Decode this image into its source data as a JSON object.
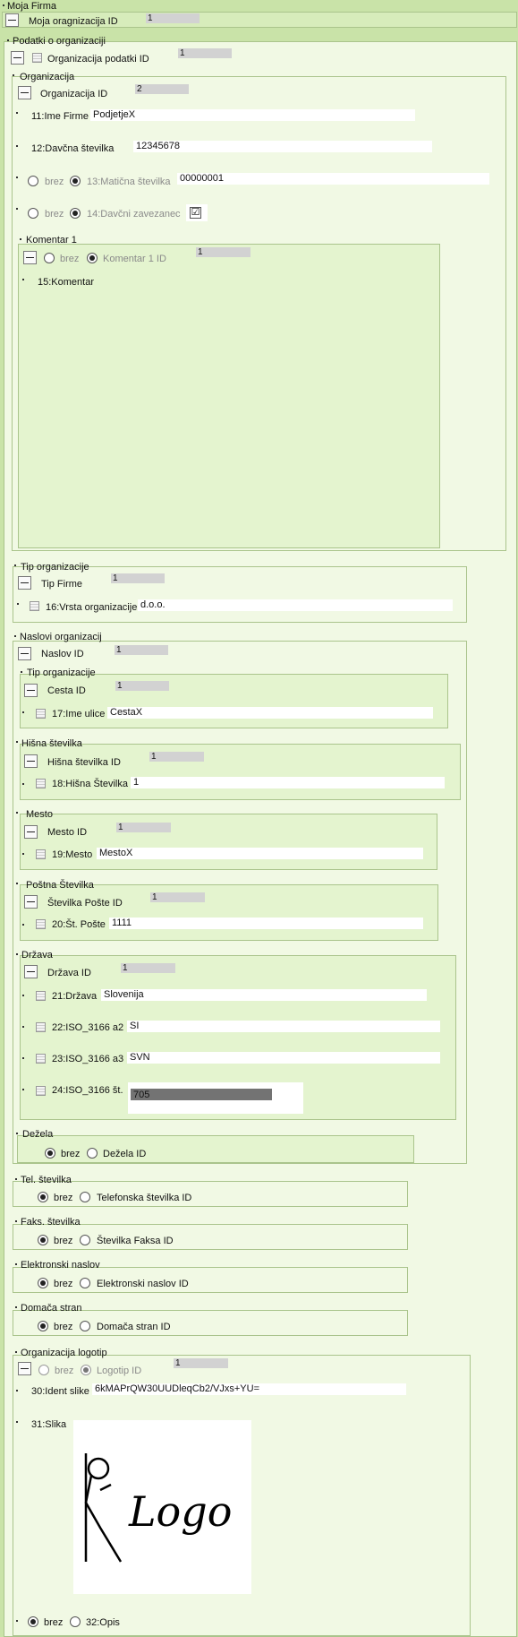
{
  "root": {
    "title": "Moja Firma",
    "id_label": "Moja oragnizacija ID",
    "id_value": "1"
  },
  "podatki": {
    "title": "Podatki o organizaciji",
    "id_label": "Organizacija podatki ID",
    "id_value": "1"
  },
  "organizacija": {
    "title": "Organizacija",
    "id_label": "Organizacija ID",
    "id_value": "2",
    "ime_label": "11:Ime Firme",
    "ime_value": "PodjetjeX",
    "davcna_label": "12:Davčna številka",
    "davcna_value": "12345678",
    "brez": "brez",
    "maticna_label": "13:Matična številka",
    "maticna_value": "00000001",
    "zavezanec_label": "14:Davčni zavezanec",
    "zavezanec_check": "☑"
  },
  "komentar": {
    "title": "Komentar 1",
    "brez": "brez",
    "id_label": "Komentar 1 ID",
    "id_value": "1",
    "field_label": "15:Komentar"
  },
  "tip_org": {
    "title": "Tip organizacije",
    "id_label": "Tip Firme",
    "id_value": "1",
    "field_label": "16:Vrsta organizacije",
    "field_value": "d.o.o."
  },
  "naslovi": {
    "title": "Naslovi organizacij",
    "id_label": "Naslov ID",
    "id_value": "1",
    "cesta": {
      "title": "Tip organizacije",
      "id_label": "Cesta ID",
      "id_value": "1",
      "field_label": "17:Ime ulice",
      "field_value": "CestaX"
    },
    "hisna": {
      "title": "Hišna številka",
      "id_label": "Hišna številka ID",
      "id_value": "1",
      "field_label": "18:Hišna Številka",
      "field_value": "1"
    },
    "mesto": {
      "title": "Mesto",
      "id_label": "Mesto ID",
      "id_value": "1",
      "field_label": "19:Mesto",
      "field_value": "MestoX"
    },
    "posta": {
      "title": "Poštna Številka",
      "id_label": "Številka Pošte ID",
      "id_value": "1",
      "field_label": "20:Št. Pošte",
      "field_value": "1111"
    },
    "drzava": {
      "title": "Država",
      "id_label": "Država ID",
      "id_value": "1",
      "f21_label": "21:Država",
      "f21_value": "Slovenija",
      "f22_label": "22:ISO_3166 a2",
      "f22_value": "SI",
      "f23_label": "23:ISO_3166 a3",
      "f23_value": "SVN",
      "f24_label": "24:ISO_3166 št.",
      "f24_value": "705"
    },
    "dezela": {
      "title": "Dežela",
      "brez": "brez",
      "id_label": "Dežela ID"
    }
  },
  "tel": {
    "title": "Tel. številka",
    "brez": "brez",
    "id_label": "Telefonska številka ID"
  },
  "faks": {
    "title": "Faks. številka",
    "brez": "brez",
    "id_label": "Številka Faksa ID"
  },
  "email": {
    "title": "Elektronski naslov",
    "brez": "brez",
    "id_label": "Elektronski naslov ID"
  },
  "domaca": {
    "title": "Domača stran",
    "brez": "brez",
    "id_label": "Domača stran ID"
  },
  "logotip": {
    "title": "Organizacija logotip",
    "brez": "brez",
    "id_label": "Logotip ID",
    "id_value": "1",
    "ident_label": "30:Ident slike",
    "ident_value": "6kMAPrQW30UUDleqCb2/VJxs+YU=",
    "slika_label": "31:Slika",
    "logo_text": "Logo",
    "opis_brez": "brez",
    "opis_label": "32:Opis"
  }
}
